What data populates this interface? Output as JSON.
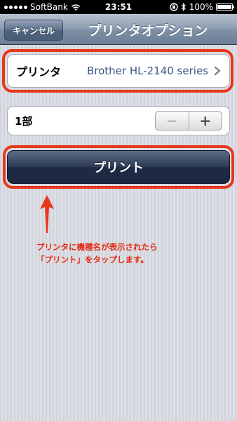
{
  "status_bar": {
    "carrier": "SoftBank",
    "time": "23:51",
    "battery": "100%",
    "battery_level": 1.0,
    "signal_icon": "signal-dots-icon",
    "wifi_icon": "wifi-icon",
    "lock_icon": "rotation-lock-icon",
    "bluetooth_icon": "bluetooth-icon"
  },
  "nav": {
    "cancel_label": "キャンセル",
    "title": "プリンタオプション"
  },
  "printer": {
    "label": "プリンタ",
    "value": "Brother HL-2140 series",
    "chevron_icon": "chevron-right-icon"
  },
  "copies": {
    "label": "1部",
    "minus": "−",
    "plus": "+"
  },
  "print_button": {
    "label": "プリント"
  },
  "annotation": {
    "line1": "プリンタに機種名が表示されたら",
    "line2": "「プリント」をタップします。",
    "arrow_icon": "arrow-up-icon",
    "color": "#e8361b"
  }
}
